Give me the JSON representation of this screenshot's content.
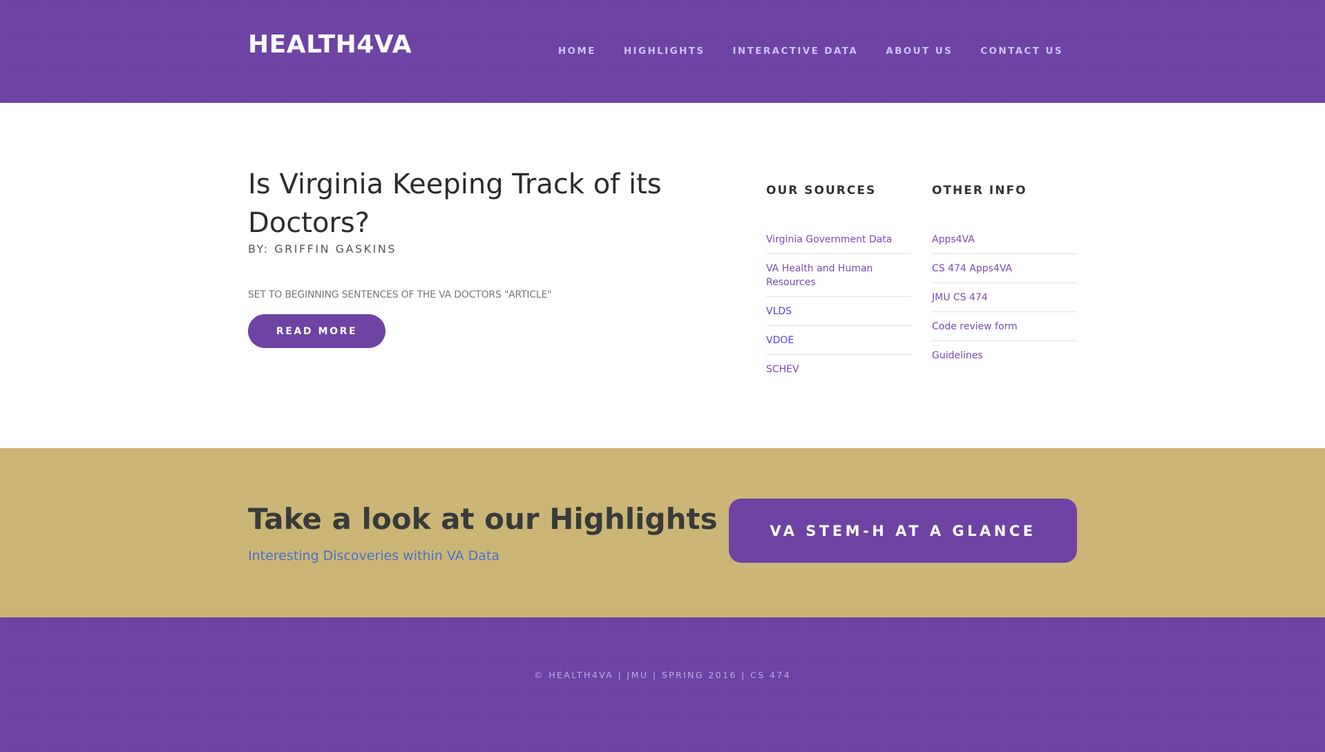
{
  "header": {
    "brand": "HEALTH4VA",
    "nav": [
      {
        "label": "HOME"
      },
      {
        "label": "HIGHLIGHTS"
      },
      {
        "label": "INTERACTIVE DATA"
      },
      {
        "label": "ABOUT US"
      },
      {
        "label": "CONTACT US"
      }
    ]
  },
  "article": {
    "title": "Is Virginia Keeping Track of its Doctors?",
    "byline": "BY: GRIFFIN GASKINS",
    "excerpt": "SET TO BEGINNING SENTENCES OF THE VA DOCTORS \"ARTICLE\"",
    "read_more_label": "READ MORE"
  },
  "sources": {
    "heading": "OUR SOURCES",
    "items": [
      {
        "label": "Virginia Government Data"
      },
      {
        "label": "VA Health and Human Resources"
      },
      {
        "label": "VLDS"
      },
      {
        "label": "VDOE"
      },
      {
        "label": "SCHEV"
      }
    ]
  },
  "other_info": {
    "heading": "OTHER INFO",
    "items": [
      {
        "label": "Apps4VA"
      },
      {
        "label": "CS 474 Apps4VA"
      },
      {
        "label": "JMU CS 474"
      },
      {
        "label": "Code review form"
      },
      {
        "label": "Guidelines"
      }
    ]
  },
  "callout": {
    "title": "Take a look at our Highlights",
    "subtitle": "Interesting Discoveries within VA Data",
    "button_label": "VA STEM-H AT A GLANCE"
  },
  "footer": {
    "text": "© HEALTH4VA | JMU | SPRING 2016 | CS 474"
  },
  "colors": {
    "brand_purple": "#6e43a4",
    "callout_gold": "#cbb677",
    "link_purple": "#7a4bb3",
    "link_blue": "#5a3fd6",
    "subtitle_blue": "#4a6fc7"
  }
}
